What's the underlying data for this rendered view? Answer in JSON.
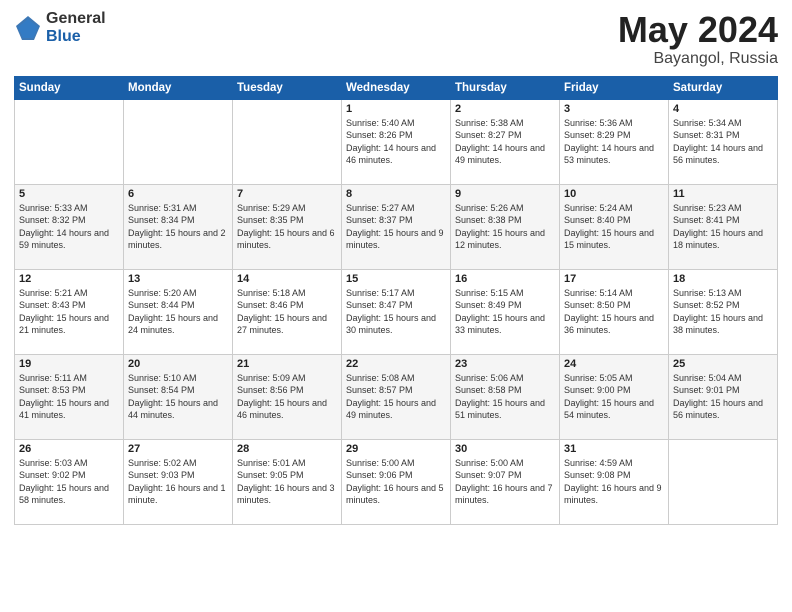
{
  "logo": {
    "general": "General",
    "blue": "Blue"
  },
  "calendar": {
    "title": "May 2024",
    "subtitle": "Bayangol, Russia"
  },
  "weekdays": [
    "Sunday",
    "Monday",
    "Tuesday",
    "Wednesday",
    "Thursday",
    "Friday",
    "Saturday"
  ],
  "weeks": [
    [
      {
        "day": "",
        "sunrise": "",
        "sunset": "",
        "daylight": ""
      },
      {
        "day": "",
        "sunrise": "",
        "sunset": "",
        "daylight": ""
      },
      {
        "day": "",
        "sunrise": "",
        "sunset": "",
        "daylight": ""
      },
      {
        "day": "1",
        "sunrise": "Sunrise: 5:40 AM",
        "sunset": "Sunset: 8:26 PM",
        "daylight": "Daylight: 14 hours and 46 minutes."
      },
      {
        "day": "2",
        "sunrise": "Sunrise: 5:38 AM",
        "sunset": "Sunset: 8:27 PM",
        "daylight": "Daylight: 14 hours and 49 minutes."
      },
      {
        "day": "3",
        "sunrise": "Sunrise: 5:36 AM",
        "sunset": "Sunset: 8:29 PM",
        "daylight": "Daylight: 14 hours and 53 minutes."
      },
      {
        "day": "4",
        "sunrise": "Sunrise: 5:34 AM",
        "sunset": "Sunset: 8:31 PM",
        "daylight": "Daylight: 14 hours and 56 minutes."
      }
    ],
    [
      {
        "day": "5",
        "sunrise": "Sunrise: 5:33 AM",
        "sunset": "Sunset: 8:32 PM",
        "daylight": "Daylight: 14 hours and 59 minutes."
      },
      {
        "day": "6",
        "sunrise": "Sunrise: 5:31 AM",
        "sunset": "Sunset: 8:34 PM",
        "daylight": "Daylight: 15 hours and 2 minutes."
      },
      {
        "day": "7",
        "sunrise": "Sunrise: 5:29 AM",
        "sunset": "Sunset: 8:35 PM",
        "daylight": "Daylight: 15 hours and 6 minutes."
      },
      {
        "day": "8",
        "sunrise": "Sunrise: 5:27 AM",
        "sunset": "Sunset: 8:37 PM",
        "daylight": "Daylight: 15 hours and 9 minutes."
      },
      {
        "day": "9",
        "sunrise": "Sunrise: 5:26 AM",
        "sunset": "Sunset: 8:38 PM",
        "daylight": "Daylight: 15 hours and 12 minutes."
      },
      {
        "day": "10",
        "sunrise": "Sunrise: 5:24 AM",
        "sunset": "Sunset: 8:40 PM",
        "daylight": "Daylight: 15 hours and 15 minutes."
      },
      {
        "day": "11",
        "sunrise": "Sunrise: 5:23 AM",
        "sunset": "Sunset: 8:41 PM",
        "daylight": "Daylight: 15 hours and 18 minutes."
      }
    ],
    [
      {
        "day": "12",
        "sunrise": "Sunrise: 5:21 AM",
        "sunset": "Sunset: 8:43 PM",
        "daylight": "Daylight: 15 hours and 21 minutes."
      },
      {
        "day": "13",
        "sunrise": "Sunrise: 5:20 AM",
        "sunset": "Sunset: 8:44 PM",
        "daylight": "Daylight: 15 hours and 24 minutes."
      },
      {
        "day": "14",
        "sunrise": "Sunrise: 5:18 AM",
        "sunset": "Sunset: 8:46 PM",
        "daylight": "Daylight: 15 hours and 27 minutes."
      },
      {
        "day": "15",
        "sunrise": "Sunrise: 5:17 AM",
        "sunset": "Sunset: 8:47 PM",
        "daylight": "Daylight: 15 hours and 30 minutes."
      },
      {
        "day": "16",
        "sunrise": "Sunrise: 5:15 AM",
        "sunset": "Sunset: 8:49 PM",
        "daylight": "Daylight: 15 hours and 33 minutes."
      },
      {
        "day": "17",
        "sunrise": "Sunrise: 5:14 AM",
        "sunset": "Sunset: 8:50 PM",
        "daylight": "Daylight: 15 hours and 36 minutes."
      },
      {
        "day": "18",
        "sunrise": "Sunrise: 5:13 AM",
        "sunset": "Sunset: 8:52 PM",
        "daylight": "Daylight: 15 hours and 38 minutes."
      }
    ],
    [
      {
        "day": "19",
        "sunrise": "Sunrise: 5:11 AM",
        "sunset": "Sunset: 8:53 PM",
        "daylight": "Daylight: 15 hours and 41 minutes."
      },
      {
        "day": "20",
        "sunrise": "Sunrise: 5:10 AM",
        "sunset": "Sunset: 8:54 PM",
        "daylight": "Daylight: 15 hours and 44 minutes."
      },
      {
        "day": "21",
        "sunrise": "Sunrise: 5:09 AM",
        "sunset": "Sunset: 8:56 PM",
        "daylight": "Daylight: 15 hours and 46 minutes."
      },
      {
        "day": "22",
        "sunrise": "Sunrise: 5:08 AM",
        "sunset": "Sunset: 8:57 PM",
        "daylight": "Daylight: 15 hours and 49 minutes."
      },
      {
        "day": "23",
        "sunrise": "Sunrise: 5:06 AM",
        "sunset": "Sunset: 8:58 PM",
        "daylight": "Daylight: 15 hours and 51 minutes."
      },
      {
        "day": "24",
        "sunrise": "Sunrise: 5:05 AM",
        "sunset": "Sunset: 9:00 PM",
        "daylight": "Daylight: 15 hours and 54 minutes."
      },
      {
        "day": "25",
        "sunrise": "Sunrise: 5:04 AM",
        "sunset": "Sunset: 9:01 PM",
        "daylight": "Daylight: 15 hours and 56 minutes."
      }
    ],
    [
      {
        "day": "26",
        "sunrise": "Sunrise: 5:03 AM",
        "sunset": "Sunset: 9:02 PM",
        "daylight": "Daylight: 15 hours and 58 minutes."
      },
      {
        "day": "27",
        "sunrise": "Sunrise: 5:02 AM",
        "sunset": "Sunset: 9:03 PM",
        "daylight": "Daylight: 16 hours and 1 minute."
      },
      {
        "day": "28",
        "sunrise": "Sunrise: 5:01 AM",
        "sunset": "Sunset: 9:05 PM",
        "daylight": "Daylight: 16 hours and 3 minutes."
      },
      {
        "day": "29",
        "sunrise": "Sunrise: 5:00 AM",
        "sunset": "Sunset: 9:06 PM",
        "daylight": "Daylight: 16 hours and 5 minutes."
      },
      {
        "day": "30",
        "sunrise": "Sunrise: 5:00 AM",
        "sunset": "Sunset: 9:07 PM",
        "daylight": "Daylight: 16 hours and 7 minutes."
      },
      {
        "day": "31",
        "sunrise": "Sunrise: 4:59 AM",
        "sunset": "Sunset: 9:08 PM",
        "daylight": "Daylight: 16 hours and 9 minutes."
      },
      {
        "day": "",
        "sunrise": "",
        "sunset": "",
        "daylight": ""
      }
    ]
  ]
}
